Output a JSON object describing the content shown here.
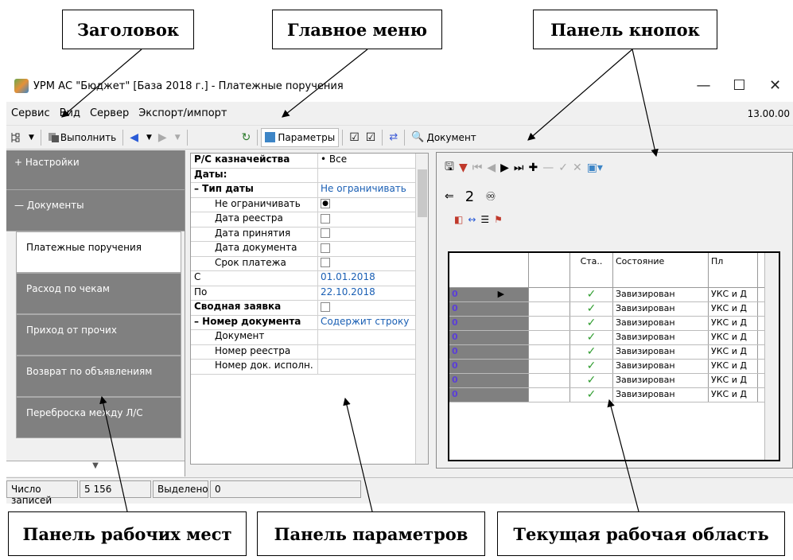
{
  "callouts": {
    "title": "Заголовок",
    "main_menu": "Главное меню",
    "button_panel": "Панель кнопок",
    "workplaces_panel": "Панель рабочих мест",
    "params_panel": "Панель параметров",
    "work_area": "Текущая рабочая область"
  },
  "window": {
    "title": "УРМ АС \"Бюджет\" [База 2018 г.] - Платежные поручения",
    "minimize": "—",
    "maximize": "☐",
    "close": "✕"
  },
  "menu": {
    "items": [
      "Сервис",
      "Вид",
      "Сервер",
      "Экспорт/импорт"
    ],
    "version": "13.00.00"
  },
  "toolbar": {
    "execute": "Выполнить",
    "params": "Параметры",
    "document": "Документ"
  },
  "sidebar": {
    "groups": [
      "Настройки",
      "Документы"
    ],
    "group_marks": [
      "+",
      "—"
    ],
    "items": [
      "Платежные поручения",
      "Расход по чекам",
      "Приход от прочих",
      "Возврат по объявлениям",
      "Переброска между Л/С"
    ],
    "bottom_arrow": "▼"
  },
  "params": {
    "rows": [
      {
        "name": "Р/С казначейства",
        "value": "• Все",
        "style": "bold"
      },
      {
        "name": "Даты:",
        "value": "",
        "style": "bold"
      },
      {
        "name": "– Тип даты",
        "value": "Не ограничивать",
        "style": "bold"
      },
      {
        "name": "Не ограничивать",
        "value": "●",
        "style": "ind"
      },
      {
        "name": "Дата реестра",
        "value": "",
        "style": "ind"
      },
      {
        "name": "Дата принятия",
        "value": "",
        "style": "ind"
      },
      {
        "name": "Дата документа",
        "value": "",
        "style": "ind"
      },
      {
        "name": "Срок платежа",
        "value": "",
        "style": "ind"
      },
      {
        "name": "С",
        "value": "01.01.2018",
        "style": ""
      },
      {
        "name": "По",
        "value": "22.10.2018",
        "style": ""
      },
      {
        "name": "Сводная заявка",
        "value": "",
        "style": "bold"
      },
      {
        "name": "– Номер документа",
        "value": "Содержит строку",
        "style": "bold"
      },
      {
        "name": "Документ",
        "value": "",
        "style": "ind"
      },
      {
        "name": "Номер реестра",
        "value": "",
        "style": "ind"
      },
      {
        "name": "Номер док. исполн.",
        "value": "",
        "style": "ind"
      }
    ]
  },
  "workarea": {
    "nav_number": "2",
    "grid_headers": [
      "",
      "",
      "Ста..",
      "Состояние",
      "Пл"
    ],
    "row_marker": "0",
    "check_mark": "✓",
    "rows": [
      {
        "status": "Завизирован",
        "payer": "УКС и Д"
      },
      {
        "status": "Завизирован",
        "payer": "УКС и Д"
      },
      {
        "status": "Завизирован",
        "payer": "УКС и Д"
      },
      {
        "status": "Завизирован",
        "payer": "УКС и Д"
      },
      {
        "status": "Завизирован",
        "payer": "УКС и Д"
      },
      {
        "status": "Завизирован",
        "payer": "УКС и Д"
      },
      {
        "status": "Завизирован",
        "payer": "УКС и Д"
      },
      {
        "status": "Завизирован",
        "payer": "УКС и Д"
      }
    ]
  },
  "statusbar": {
    "records_label": "Число записей",
    "records_value": "5 156",
    "selected_label": "Выделено",
    "selected_value": "0"
  },
  "colors": {
    "accent": "#1a5fb4",
    "sidebar": "#808080",
    "check": "#2e9c2e"
  }
}
